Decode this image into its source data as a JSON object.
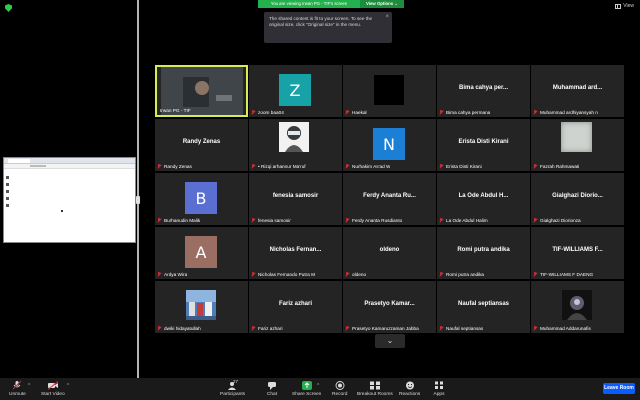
{
  "banner": {
    "message": "You are viewing Irwan PG - TIF's screen",
    "view_options": "View Options ⌄"
  },
  "tooltip": {
    "text": "The shared content is fit to your screen. To see the original size, click \"Original size\" in the menu.",
    "close": "×"
  },
  "view_button": {
    "label": "View"
  },
  "participants": [
    {
      "name": "Irwan PG - TIF",
      "type": "video",
      "active": true
    },
    {
      "name": "zoom baa04",
      "type": "avatar",
      "letter": "Z",
      "color": "#17a2a8"
    },
    {
      "name": "Haekal",
      "type": "black"
    },
    {
      "name": "Bima cahya permana",
      "type": "title",
      "title": "Bima cahya per..."
    },
    {
      "name": "Muhammad ardhiyansyah n",
      "type": "title",
      "title": "Muhammad ard..."
    },
    {
      "name": "Randy Zenas",
      "type": "title",
      "title": "Randy Zenas"
    },
    {
      "name": "• Rizqi arhannur Ma'ruf",
      "type": "photo-anime"
    },
    {
      "name": "Nurhakim As'ad W",
      "type": "avatar",
      "letter": "N",
      "color": "#1b7fd6"
    },
    {
      "name": "Erista Disti Kirani",
      "type": "title",
      "title": "Erista Disti Kirani"
    },
    {
      "name": "Fazrah Rahmawati",
      "type": "photo-grey"
    },
    {
      "name": "Burhanudin Malik",
      "type": "avatar",
      "letter": "B",
      "color": "#5a6fd1"
    },
    {
      "name": "fenesia samosir",
      "type": "title",
      "title": "fenesia samosir"
    },
    {
      "name": "Ferdy Ananta Rusdianto",
      "type": "title",
      "title": "Ferdy Ananta Ru..."
    },
    {
      "name": "La Ode Abdul Halim",
      "type": "title",
      "title": "La Ode Abdul H..."
    },
    {
      "name": "Gialghazi Diorionza",
      "type": "title",
      "title": "Gialghazi Diorio..."
    },
    {
      "name": "Ardya Wira",
      "type": "avatar",
      "letter": "A",
      "color": "#9a6e62"
    },
    {
      "name": "Nicholas Fernando Putra M",
      "type": "title",
      "title": "Nicholas Fernan..."
    },
    {
      "name": "oldeno",
      "type": "title",
      "title": "oldeno"
    },
    {
      "name": "Romi putra andika",
      "type": "title",
      "title": "Romi putra andika"
    },
    {
      "name": "TIF-WILLIAMS F DAENG",
      "type": "title",
      "title": "TIF-WILLIAMS F..."
    },
    {
      "name": "dwiki hidayatullah",
      "type": "photo-group"
    },
    {
      "name": "Fariz azhari",
      "type": "title",
      "title": "Fariz azhari"
    },
    {
      "name": "Prasetyo Kamaruzzaman Jabba",
      "type": "title",
      "title": "Prasetyo Kamar..."
    },
    {
      "name": "Naufal septiansas",
      "type": "title",
      "title": "Naufal septiansas"
    },
    {
      "name": "Muhammad Addarunafis",
      "type": "photo-dark"
    }
  ],
  "toolbar": {
    "unmute": "Unmute",
    "start_video": "Start Video",
    "participants": "Participants",
    "participants_count": "27",
    "chat": "Chat",
    "share_screen": "Share Screen",
    "record": "Record",
    "breakout_rooms": "Breakout Rooms",
    "reactions": "Reactions",
    "apps": "Apps",
    "leave_room": "Leave Room"
  },
  "colors": {
    "banner_green": "#23b14d",
    "active_border": "#d9ec4f",
    "muted_red": "#e02828",
    "leave_blue": "#0b5cff"
  }
}
